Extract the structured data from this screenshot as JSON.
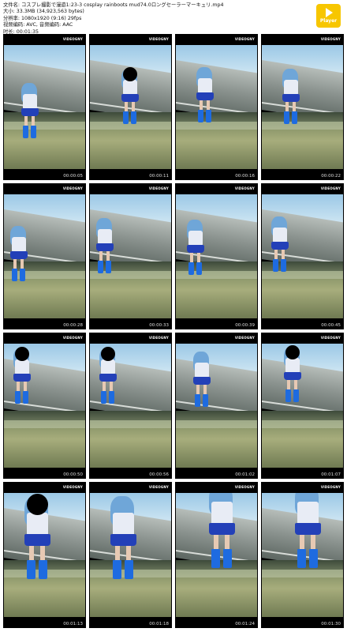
{
  "header": {
    "lines": [
      "文件名: コスプレ撮影で漫遊1:23-3 cosplay rainboots mud74.0ロングセーラーマーキュリ.mp4",
      "大小: 33.3MB (34,923,563 bytes)",
      "分辨率: 1080x1920 (9:16) 29fps",
      "视频编码: AVC, 音频编码: AAC",
      "时长: 00:01:35"
    ]
  },
  "player_button": {
    "label": "Player"
  },
  "watermark": "VIDEOGNY",
  "thumbnails": [
    {
      "time": "00:00:05"
    },
    {
      "time": "00:00:11"
    },
    {
      "time": "00:00:16"
    },
    {
      "time": "00:00:22"
    },
    {
      "time": "00:00:28"
    },
    {
      "time": "00:00:33"
    },
    {
      "time": "00:00:39"
    },
    {
      "time": "00:00:45"
    },
    {
      "time": "00:00:50"
    },
    {
      "time": "00:00:56"
    },
    {
      "time": "00:01:02"
    },
    {
      "time": "00:01:07"
    },
    {
      "time": "00:01:13"
    },
    {
      "time": "00:01:18"
    },
    {
      "time": "00:01:24"
    },
    {
      "time": "00:01:30"
    }
  ],
  "colors": {
    "player": "#f7c600",
    "skirt": "#2340b8",
    "boots": "#1e6be0",
    "hair": "#6fa6d8"
  }
}
